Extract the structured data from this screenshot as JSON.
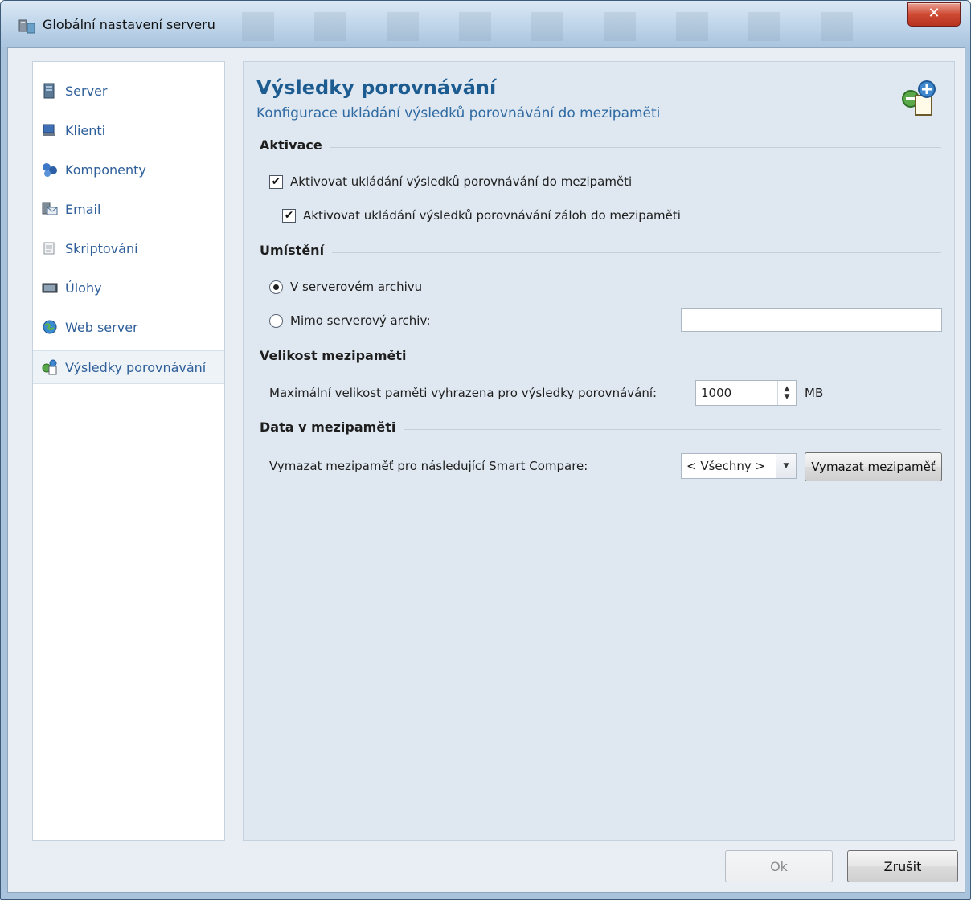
{
  "window": {
    "title": "Globální nastavení serveru",
    "close_glyph": "✕"
  },
  "sidebar": {
    "items": [
      {
        "label": "Server",
        "icon": "server-icon"
      },
      {
        "label": "Klienti",
        "icon": "clients-icon"
      },
      {
        "label": "Komponenty",
        "icon": "components-icon"
      },
      {
        "label": "Email",
        "icon": "email-icon"
      },
      {
        "label": "Skriptování",
        "icon": "script-icon"
      },
      {
        "label": "Úlohy",
        "icon": "tasks-icon"
      },
      {
        "label": "Web server",
        "icon": "web-server-icon"
      },
      {
        "label": "Výsledky porovnávání",
        "icon": "compare-results-icon",
        "selected": true
      }
    ]
  },
  "page": {
    "title": "Výsledky porovnávání",
    "subtitle": "Konfigurace ukládání výsledků porovnávání do mezipaměti"
  },
  "activation": {
    "heading": "Aktivace",
    "enable_cache_label": "Aktivovat ukládání výsledků porovnávání do mezipaměti",
    "enable_cache_checked": true,
    "enable_backup_cache_label": "Aktivovat ukládání výsledků porovnávání záloh do mezipaměti",
    "enable_backup_cache_checked": true,
    "check_glyph": "✔"
  },
  "location": {
    "heading": "Umístění",
    "option_server_label": "V serverovém archivu",
    "option_outside_label": "Mimo serverový archiv:",
    "selected": "server",
    "outside_path": ""
  },
  "cache_size": {
    "heading": "Velikost mezipaměti",
    "max_label": "Maximální velikost paměti vyhrazena pro výsledky porovnávání:",
    "value": "1000",
    "unit": "MB",
    "spin_up": "▲",
    "spin_down": "▼"
  },
  "cache_data": {
    "heading": "Data v mezipaměti",
    "clear_label": "Vymazat mezipaměť pro následující Smart Compare:",
    "selected_option": "< Všechny >",
    "dropdown_glyph": "▼",
    "clear_button": "Vymazat mezipaměť"
  },
  "footer": {
    "ok_label": "Ok",
    "cancel_label": "Zrušit"
  },
  "colors": {
    "accent": "#1d5c90",
    "nav_text": "#2e5f9a",
    "panel_bg": "#dfe8f1"
  }
}
